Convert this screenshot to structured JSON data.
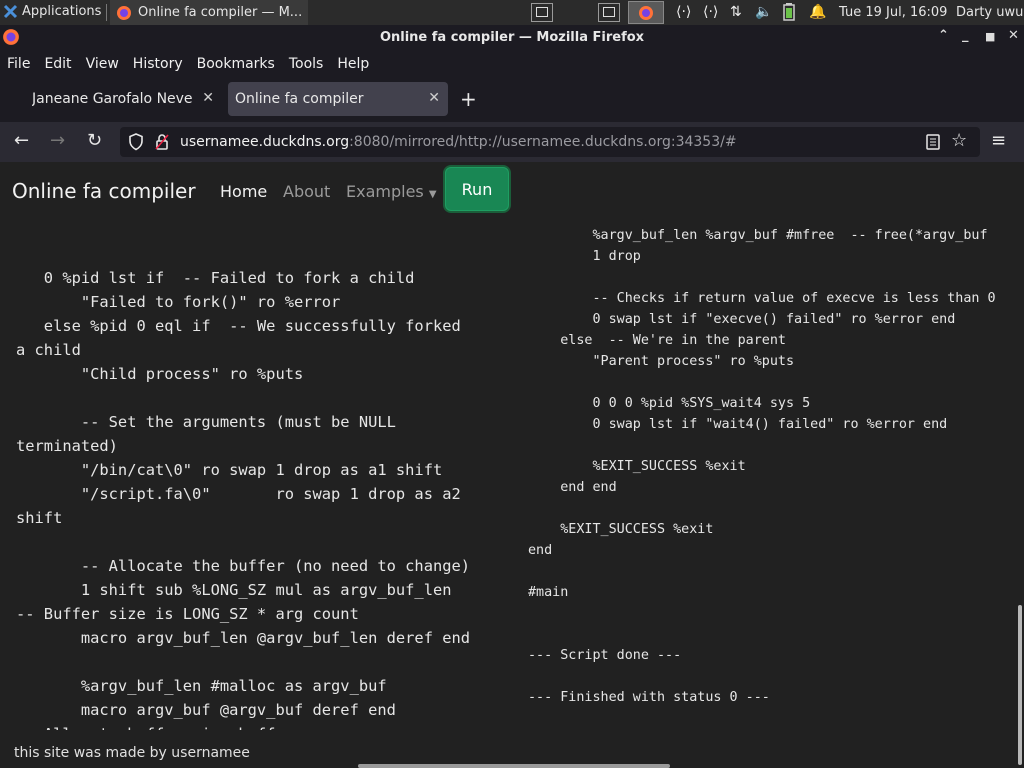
{
  "system": {
    "apps_label": "Applications",
    "task_label": "Online fa compiler — M...",
    "clock": "Tue 19 Jul, 16:09",
    "user": "Darty uwu"
  },
  "window": {
    "title": "Online fa compiler — Mozilla Firefox"
  },
  "menu": [
    "File",
    "Edit",
    "View",
    "History",
    "Bookmarks",
    "Tools",
    "Help"
  ],
  "tabs": [
    {
      "label": "Janeane Garofalo Never S",
      "active": false
    },
    {
      "label": "Online fa compiler",
      "active": true
    }
  ],
  "url": {
    "host": "usernamee.duckdns.org",
    "rest": ":8080/mirrored/http://usernamee.duckdns.org:34353/#"
  },
  "page": {
    "brand": "Online fa compiler",
    "nav": [
      "Home",
      "About",
      "Examples"
    ],
    "run_label": "Run",
    "footer": "this site was made by usernamee"
  },
  "code_left": [
    "",
    "",
    "   0 %pid lst if  -- Failed to fork a child",
    "       \"Failed to fork()\" ro %error",
    "   else %pid 0 eql if  -- We successfully forked",
    "a child",
    "       \"Child process\" ro %puts",
    "",
    "       -- Set the arguments (must be NULL",
    "terminated)",
    "       \"/bin/cat\\0\" ro swap 1 drop as a1 shift",
    "       \"/script.fa\\0\"       ro swap 1 drop as a2",
    "shift",
    "",
    "       -- Allocate the buffer (no need to change)",
    "       1 shift sub %LONG_SZ mul as argv_buf_len",
    "-- Buffer size is LONG_SZ * arg count",
    "       macro argv_buf_len @argv_buf_len deref end",
    "",
    "       %argv_buf_len #malloc as argv_buf",
    "       macro argv_buf @argv_buf deref end",
    "-- Allocate buffer size buffer"
  ],
  "code_right": [
    "",
    "        %argv_buf_len %argv_buf #mfree  -- free(*argv_buf",
    "        1 drop",
    "",
    "        -- Checks if return value of execve is less than 0",
    "        0 swap lst if \"execve() failed\" ro %error end",
    "    else  -- We're in the parent",
    "        \"Parent process\" ro %puts",
    "",
    "        0 0 0 %pid %SYS_wait4 sys 5",
    "        0 swap lst if \"wait4() failed\" ro %error end",
    "",
    "        %EXIT_SUCCESS %exit",
    "    end end",
    "",
    "    %EXIT_SUCCESS %exit",
    "end",
    "",
    "#main",
    "",
    "",
    "--- Script done ---",
    "",
    "--- Finished with status 0 ---"
  ]
}
